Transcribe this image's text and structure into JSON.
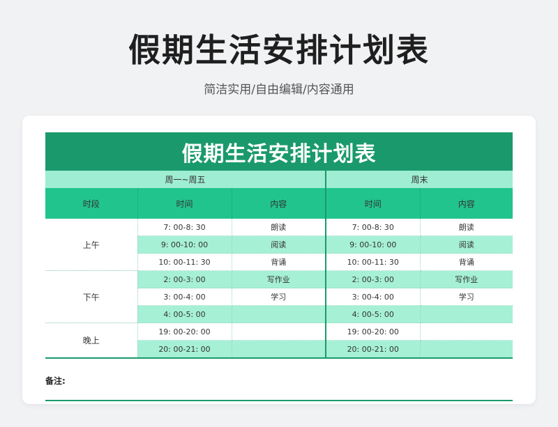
{
  "page": {
    "title": "假期生活安排计划表",
    "subtitle": "简洁实用/自由编辑/内容通用"
  },
  "sheet": {
    "title": "假期生活安排计划表",
    "groups": {
      "weekday": "周一~周五",
      "weekend": "周末"
    },
    "headers": {
      "period": "时段",
      "weekday_time": "时间",
      "weekday_content": "内容",
      "weekend_time": "时间",
      "weekend_content": "内容"
    },
    "periods": [
      "上午",
      "下午",
      "晚上"
    ],
    "rows": [
      {
        "wd_time": "7: 00-8: 30",
        "wd_content": "朗读",
        "we_time": "7: 00-8: 30",
        "we_content": "朗读"
      },
      {
        "wd_time": "9: 00-10: 00",
        "wd_content": "阅读",
        "we_time": "9: 00-10: 00",
        "we_content": "阅读"
      },
      {
        "wd_time": "10: 00-11: 30",
        "wd_content": "背诵",
        "we_time": "10: 00-11: 30",
        "we_content": "背诵"
      },
      {
        "wd_time": "2: 00-3: 00",
        "wd_content": "写作业",
        "we_time": "2: 00-3: 00",
        "we_content": "写作业"
      },
      {
        "wd_time": "3: 00-4: 00",
        "wd_content": "学习",
        "we_time": "3: 00-4: 00",
        "we_content": "学习"
      },
      {
        "wd_time": "4: 00-5: 00",
        "wd_content": "",
        "we_time": "4: 00-5: 00",
        "we_content": ""
      },
      {
        "wd_time": "19: 00-20: 00",
        "wd_content": "",
        "we_time": "19: 00-20: 00",
        "we_content": ""
      },
      {
        "wd_time": "20: 00-21: 00",
        "wd_content": "",
        "we_time": "20: 00-21: 00",
        "we_content": ""
      }
    ],
    "note_label": "备注:"
  },
  "colors": {
    "title_bg": "#1a9a6c",
    "header_bg": "#22c48d",
    "group_bg": "#9fedd2",
    "row_shade": "#a6f0d6"
  }
}
